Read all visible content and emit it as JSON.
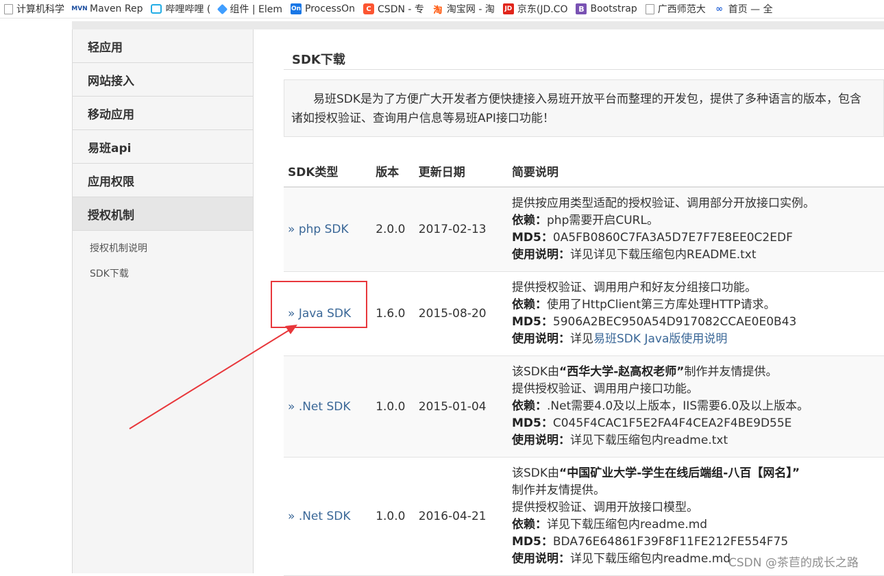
{
  "bookmarks": [
    {
      "label": "计算机科学",
      "icon": "document-icon"
    },
    {
      "label": "Maven Rep",
      "icon": "maven-icon"
    },
    {
      "label": "哔哩哔哩 (",
      "icon": "bilibili-icon"
    },
    {
      "label": "组件 | Elem",
      "icon": "element-icon"
    },
    {
      "label": "ProcessOn",
      "icon": "processon-icon"
    },
    {
      "label": "CSDN - 专",
      "icon": "csdn-icon"
    },
    {
      "label": "淘宝网 - 淘",
      "icon": "taobao-icon"
    },
    {
      "label": "京东(JD.CO",
      "icon": "jd-icon"
    },
    {
      "label": "Bootstrap",
      "icon": "bootstrap-icon"
    },
    {
      "label": "广西师范大",
      "icon": "document-icon"
    },
    {
      "label": "首页 — 全",
      "icon": "home-site-icon"
    }
  ],
  "icon_glyphs": {
    "maven": "MVN",
    "processon": "On",
    "csdn": "C",
    "taobao": "淘",
    "jd": "JD",
    "bootstrap": "B",
    "home": "∞"
  },
  "sidebar": {
    "items": [
      {
        "label": "轻应用"
      },
      {
        "label": "网站接入"
      },
      {
        "label": "移动应用"
      },
      {
        "label": "易班api"
      },
      {
        "label": "应用权限"
      },
      {
        "label": "授权机制",
        "active": true
      }
    ],
    "subitems": [
      {
        "label": "授权机制说明"
      },
      {
        "label": "SDK下载"
      }
    ]
  },
  "main": {
    "title": "SDK下载",
    "intro_line1": "易班SDK是为了方便广大开发者方便快捷接入易班开放平台而整理的开发包，提供了多种语言的版本，包含",
    "intro_line2": "诸如授权验证、查询用户信息等易班API接口功能！",
    "table": {
      "headers": {
        "type": "SDK类型",
        "version": "版本",
        "date": "更新日期",
        "desc": "简要说明"
      },
      "link_prefix": "»",
      "rows": [
        {
          "name": "php SDK",
          "version": "2.0.0",
          "date": "2017-02-13",
          "line1": "提供按应用类型适配的授权验证、调用部分开放接口实例。",
          "dep_label": "依赖：",
          "dep": "php需要开启CURL。",
          "md5_label": "MD5：",
          "md5": "0A5FB0860C7FA3A5D7E7F7E8EE0C2EDF",
          "usage_label": "使用说明：",
          "usage": "详见详见下载压缩包内README.txt"
        },
        {
          "name": "Java SDK",
          "version": "1.6.0",
          "date": "2015-08-20",
          "line1": "提供授权验证、调用用户和好友分组接口功能。",
          "dep_label": "依赖：",
          "dep": "使用了HttpClient第三方库处理HTTP请求。",
          "md5_label": "MD5：",
          "md5": "5906A2BEC950A54D917082CCAE0E0B43",
          "usage_label": "使用说明：",
          "usage_prefix": "详见",
          "usage_link": "易班SDK Java版使用说明"
        },
        {
          "name": ".Net SDK",
          "version": "1.0.0",
          "date": "2015-01-04",
          "intro_a": "该SDK由",
          "intro_b": "“西华大学-赵高权老师”",
          "intro_c": "制作并友情提供。",
          "line1": "提供授权验证、调用用户接口功能。",
          "dep_label": "依赖：",
          "dep": ".Net需要4.0及以上版本，IIS需要6.0及以上版本。",
          "md5_label": "MD5：",
          "md5": "C045F4CAC1F5E2FA4F4CEA2F4BE9D55E",
          "usage_label": "使用说明：",
          "usage": "详见下载压缩包内readme.txt"
        },
        {
          "name": ".Net SDK",
          "version": "1.0.0",
          "date": "2016-04-21",
          "intro_a": "该SDK由",
          "intro_b": "“中国矿业大学-学生在线后端组-八百【网名】”",
          "intro_c": "制作并友情提供。",
          "line1": "提供授权验证、调用开放接口模型。",
          "dep_label": "依赖：",
          "dep": "详见下载压缩包内readme.md",
          "md5_label": "MD5：",
          "md5": "BDA76E64861F39F8F11FE212FE554F75",
          "usage_label": "使用说明：",
          "usage": "详见下载压缩包内readme.md"
        }
      ]
    }
  },
  "watermark": "CSDN @茶苣的成长之路",
  "colors": {
    "link": "#3a6797",
    "annotation": "#e8373b",
    "sidebar_bg": "#f5f5f5"
  }
}
